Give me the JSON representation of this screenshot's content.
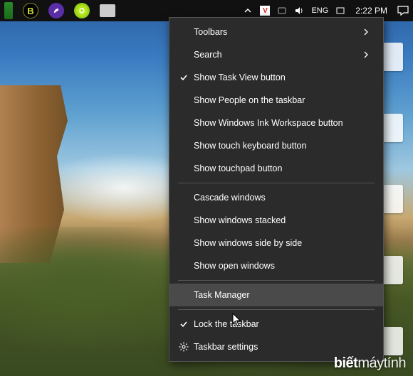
{
  "taskbar": {
    "tray": {
      "language": "ENG",
      "clock": "2:22 PM"
    }
  },
  "context_menu": {
    "groups": [
      [
        {
          "label": "Toolbars",
          "submenu": true
        },
        {
          "label": "Search",
          "submenu": true
        },
        {
          "label": "Show Task View button",
          "checked": true
        },
        {
          "label": "Show People on the taskbar"
        },
        {
          "label": "Show Windows Ink Workspace button"
        },
        {
          "label": "Show touch keyboard button"
        },
        {
          "label": "Show touchpad button"
        }
      ],
      [
        {
          "label": "Cascade windows"
        },
        {
          "label": "Show windows stacked"
        },
        {
          "label": "Show windows side by side"
        },
        {
          "label": "Show open windows"
        }
      ],
      [
        {
          "label": "Task Manager",
          "hovered": true
        }
      ],
      [
        {
          "label": "Lock the taskbar",
          "checked": true
        },
        {
          "label": "Taskbar settings",
          "icon": "gear"
        }
      ]
    ]
  },
  "watermark": {
    "brand_bold": "biết",
    "brand_rest": "máytính"
  }
}
